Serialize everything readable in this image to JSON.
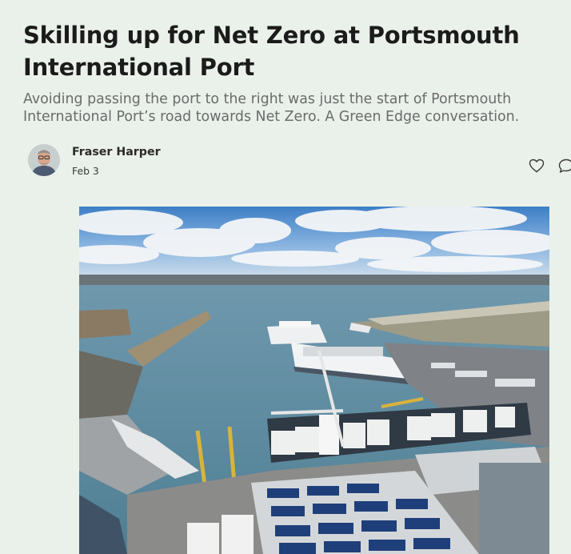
{
  "article": {
    "title": "Skilling up for Net Zero at Portsmouth International Port",
    "subtitle": "Avoiding passing the port to the right was just the start of Portsmouth International Port’s road towards Net Zero. A Green Edge conversation."
  },
  "byline": {
    "author": "Fraser Harper",
    "date": "Feb 3"
  },
  "actions": {
    "like_icon": "heart-icon",
    "comment_icon": "comment-icon"
  },
  "colors": {
    "background": "#eaf1ea",
    "title": "#1b1b1b",
    "subtitle": "#6b6b6b"
  }
}
